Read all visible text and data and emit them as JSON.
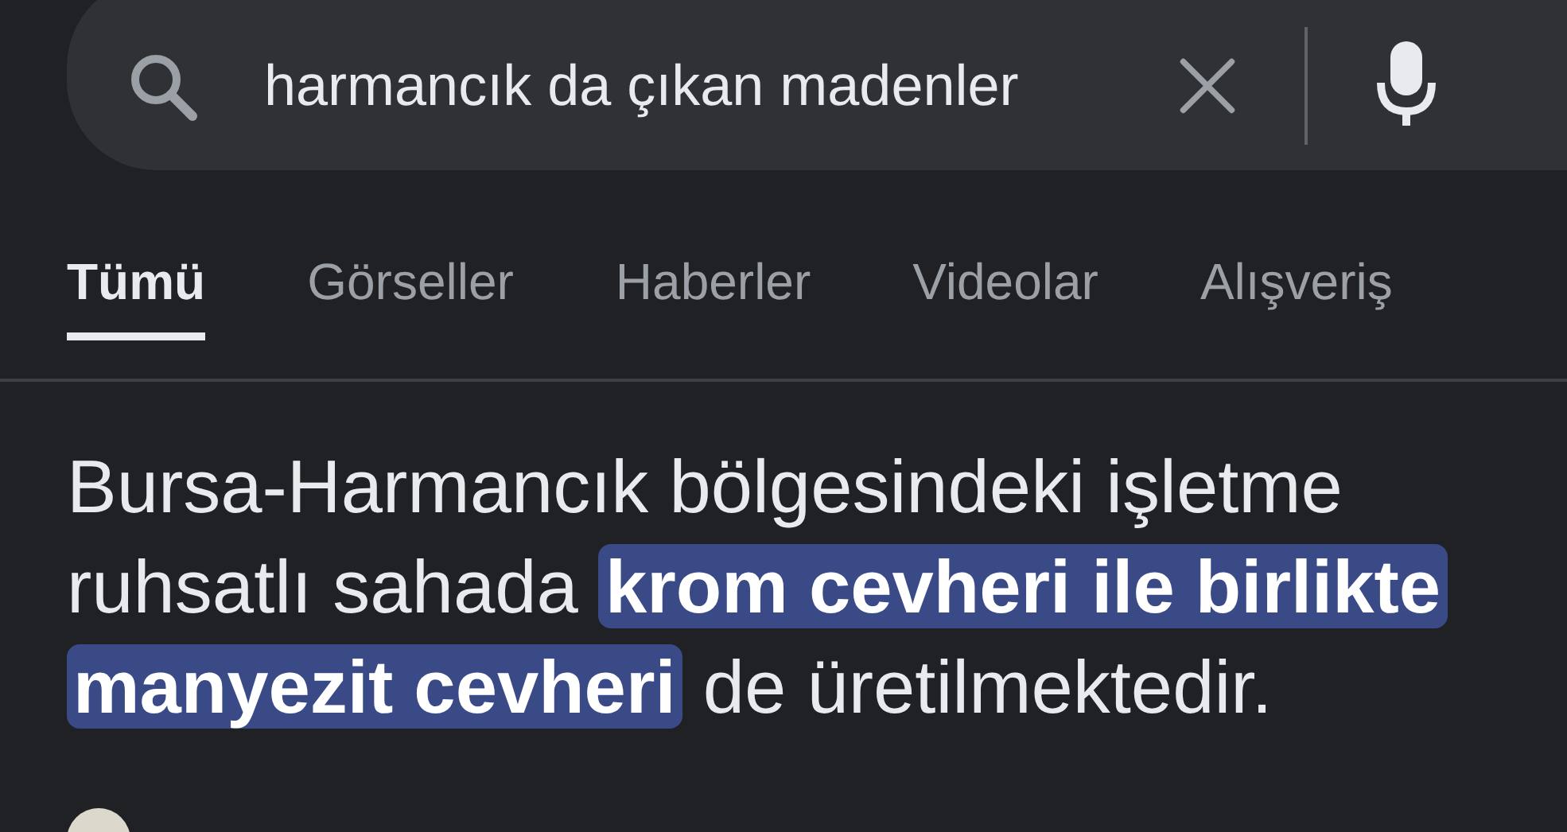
{
  "search": {
    "query": "harmancık da çıkan madenler"
  },
  "tabs": [
    {
      "label": "Tümü",
      "selected": true
    },
    {
      "label": "Görseller",
      "selected": false
    },
    {
      "label": "Haberler",
      "selected": false
    },
    {
      "label": "Videolar",
      "selected": false
    },
    {
      "label": "Alışveriş",
      "selected": false
    }
  ],
  "answer": {
    "parts": [
      {
        "text": "Bursa-Harmancık bölgesindeki işletme ruhsatlı sahada ",
        "highlighted": false
      },
      {
        "text": "krom cevheri ile birlikte manyezit cevheri",
        "highlighted": true
      },
      {
        "text": " de üretilmektedir.",
        "highlighted": false
      }
    ]
  }
}
